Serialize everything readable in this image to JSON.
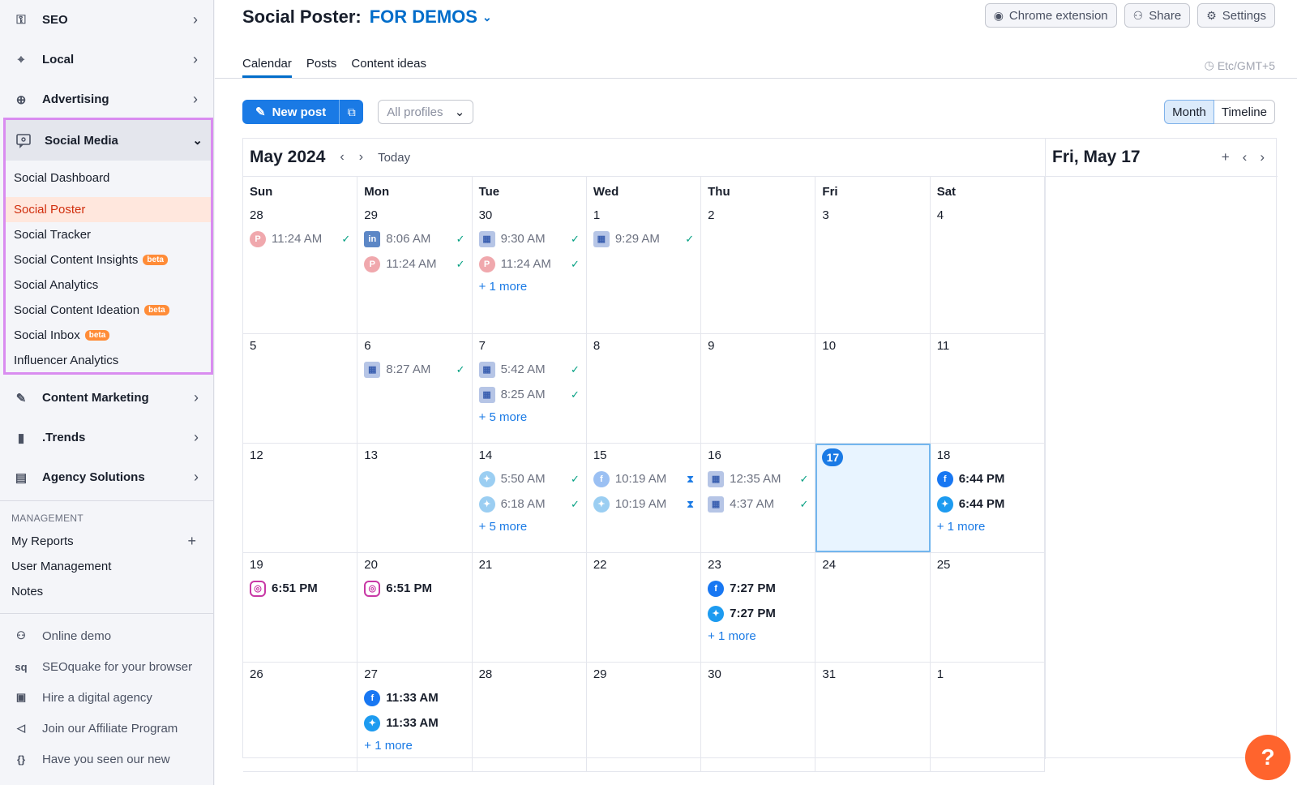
{
  "sidebar": {
    "nav_top": [
      {
        "label": "SEO",
        "icon": "key-icon"
      },
      {
        "label": "Local",
        "icon": "location-pin-icon"
      },
      {
        "label": "Advertising",
        "icon": "target-icon"
      }
    ],
    "social_media": {
      "label": "Social Media",
      "items": [
        {
          "label": "Social Dashboard",
          "beta": ""
        },
        {
          "label": "Social Poster",
          "beta": ""
        },
        {
          "label": "Social Tracker",
          "beta": ""
        },
        {
          "label": "Social Content Insights",
          "beta": "beta"
        },
        {
          "label": "Social Analytics",
          "beta": ""
        },
        {
          "label": "Social Content Ideation",
          "beta": "beta"
        },
        {
          "label": "Social Inbox",
          "beta": "beta"
        },
        {
          "label": "Influencer Analytics",
          "beta": ""
        }
      ]
    },
    "nav_bottom": [
      {
        "label": "Content Marketing",
        "icon": "pencil-icon"
      },
      {
        "label": ".Trends",
        "icon": "bar-chart-icon"
      },
      {
        "label": "Agency Solutions",
        "icon": "document-icon"
      }
    ],
    "management_title": "MANAGEMENT",
    "management": [
      "My Reports",
      "User Management",
      "Notes"
    ],
    "footer_links": [
      {
        "label": "Online demo",
        "icon": "presenter-icon"
      },
      {
        "label": "SEOquake for your browser",
        "icon": "seoquake-icon"
      },
      {
        "label": "Hire a digital agency",
        "icon": "briefcase-icon"
      },
      {
        "label": "Join our Affiliate Program",
        "icon": "megaphone-icon"
      },
      {
        "label": "Have you seen our new",
        "icon": "braces-icon"
      }
    ]
  },
  "header": {
    "title": "Social Poster:",
    "project": "FOR DEMOS",
    "buttons": {
      "chrome": "Chrome extension",
      "share": "Share",
      "settings": "Settings"
    },
    "tabs": [
      "Calendar",
      "Posts",
      "Content ideas"
    ],
    "timezone": "Etc/GMT+5"
  },
  "toolbar": {
    "new_post": "New post",
    "profiles": "All profiles",
    "view_month": "Month",
    "view_timeline": "Timeline"
  },
  "calendar": {
    "month_title": "May 2024",
    "today_label": "Today",
    "day_title": "Fri, May 17",
    "weekdays": [
      "Sun",
      "Mon",
      "Tue",
      "Wed",
      "Thu",
      "Fri",
      "Sat"
    ],
    "weeks": [
      [
        {
          "day": "28",
          "posts": [
            {
              "net": "pinterest",
              "time": "11:24 AM",
              "state": "past",
              "status": "done"
            }
          ],
          "more": ""
        },
        {
          "day": "29",
          "posts": [
            {
              "net": "linkedin",
              "time": "8:06 AM",
              "state": "past",
              "status": "done"
            },
            {
              "net": "pinterest",
              "time": "11:24 AM",
              "state": "past",
              "status": "done"
            }
          ],
          "more": ""
        },
        {
          "day": "30",
          "posts": [
            {
              "net": "gbp",
              "time": "9:30 AM",
              "state": "past",
              "status": "done"
            },
            {
              "net": "pinterest",
              "time": "11:24 AM",
              "state": "past",
              "status": "done"
            }
          ],
          "more": "+ 1 more"
        },
        {
          "day": "1",
          "posts": [
            {
              "net": "gbp",
              "time": "9:29 AM",
              "state": "past",
              "status": "done"
            }
          ],
          "more": ""
        },
        {
          "day": "2",
          "posts": [],
          "more": ""
        },
        {
          "day": "3",
          "posts": [],
          "more": ""
        },
        {
          "day": "4",
          "posts": [],
          "more": ""
        }
      ],
      [
        {
          "day": "5",
          "posts": [],
          "more": ""
        },
        {
          "day": "6",
          "posts": [
            {
              "net": "gbp",
              "time": "8:27 AM",
              "state": "past",
              "status": "done"
            }
          ],
          "more": ""
        },
        {
          "day": "7",
          "posts": [
            {
              "net": "gbp",
              "time": "5:42 AM",
              "state": "past",
              "status": "done"
            },
            {
              "net": "gbp",
              "time": "8:25 AM",
              "state": "past",
              "status": "done"
            }
          ],
          "more": "+ 5 more"
        },
        {
          "day": "8",
          "posts": [],
          "more": ""
        },
        {
          "day": "9",
          "posts": [],
          "more": ""
        },
        {
          "day": "10",
          "posts": [],
          "more": ""
        },
        {
          "day": "11",
          "posts": [],
          "more": ""
        }
      ],
      [
        {
          "day": "12",
          "posts": [],
          "more": ""
        },
        {
          "day": "13",
          "posts": [],
          "more": ""
        },
        {
          "day": "14",
          "posts": [
            {
              "net": "twitter",
              "time": "5:50 AM",
              "state": "past",
              "status": "done"
            },
            {
              "net": "twitter",
              "time": "6:18 AM",
              "state": "past",
              "status": "done"
            }
          ],
          "more": "+ 5 more"
        },
        {
          "day": "15",
          "posts": [
            {
              "net": "facebook",
              "time": "10:19 AM",
              "state": "past",
              "status": "pending"
            },
            {
              "net": "twitter",
              "time": "10:19 AM",
              "state": "past",
              "status": "pending"
            }
          ],
          "more": ""
        },
        {
          "day": "16",
          "posts": [
            {
              "net": "gbp",
              "time": "12:35 AM",
              "state": "past",
              "status": "done"
            },
            {
              "net": "gbp",
              "time": "4:37 AM",
              "state": "past",
              "status": "done"
            }
          ],
          "more": ""
        },
        {
          "day": "17",
          "posts": [],
          "more": "",
          "today": true
        },
        {
          "day": "18",
          "posts": [
            {
              "net": "facebook",
              "time": "6:44 PM",
              "state": "future",
              "status": ""
            },
            {
              "net": "twitter",
              "time": "6:44 PM",
              "state": "future",
              "status": ""
            }
          ],
          "more": "+ 1 more"
        }
      ],
      [
        {
          "day": "19",
          "posts": [
            {
              "net": "instagram",
              "time": "6:51 PM",
              "state": "future",
              "status": ""
            }
          ],
          "more": ""
        },
        {
          "day": "20",
          "posts": [
            {
              "net": "instagram",
              "time": "6:51 PM",
              "state": "future",
              "status": ""
            }
          ],
          "more": ""
        },
        {
          "day": "21",
          "posts": [],
          "more": ""
        },
        {
          "day": "22",
          "posts": [],
          "more": ""
        },
        {
          "day": "23",
          "posts": [
            {
              "net": "facebook",
              "time": "7:27 PM",
              "state": "future",
              "status": ""
            },
            {
              "net": "twitter",
              "time": "7:27 PM",
              "state": "future",
              "status": ""
            }
          ],
          "more": "+ 1 more"
        },
        {
          "day": "24",
          "posts": [],
          "more": ""
        },
        {
          "day": "25",
          "posts": [],
          "more": ""
        }
      ],
      [
        {
          "day": "26",
          "posts": [],
          "more": ""
        },
        {
          "day": "27",
          "posts": [
            {
              "net": "facebook",
              "time": "11:33 AM",
              "state": "future",
              "status": ""
            },
            {
              "net": "twitter",
              "time": "11:33 AM",
              "state": "future",
              "status": ""
            }
          ],
          "more": "+ 1 more"
        },
        {
          "day": "28",
          "posts": [],
          "more": ""
        },
        {
          "day": "29",
          "posts": [],
          "more": ""
        },
        {
          "day": "30",
          "posts": [],
          "more": ""
        },
        {
          "day": "31",
          "posts": [],
          "more": ""
        },
        {
          "day": "1",
          "posts": [],
          "more": ""
        }
      ]
    ]
  },
  "help_label": "?",
  "colors": {
    "accent": "#1a7ae5",
    "active_red": "#d12f0e",
    "highlight_border": "#d98cf0",
    "help_orange": "#ff642d"
  }
}
